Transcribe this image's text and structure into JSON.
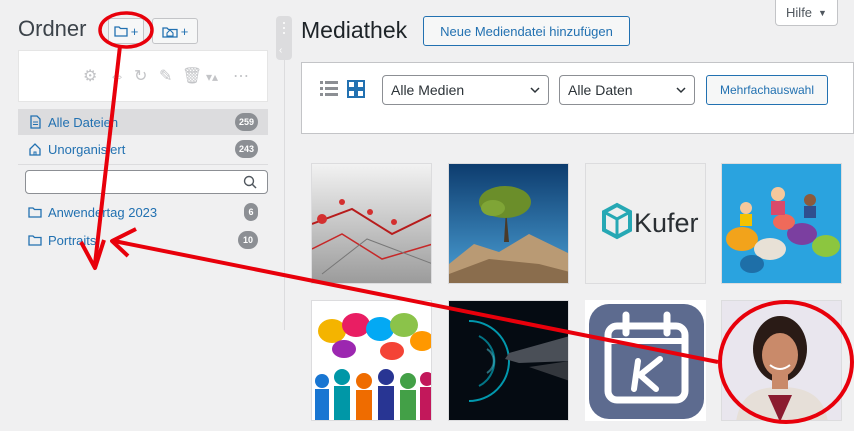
{
  "left": {
    "title": "Ordner",
    "new_folder_label": "+",
    "new_category_label": "+",
    "toolbar_icons": [
      "gear-icon",
      "move-icon",
      "refresh-icon",
      "pencil-icon",
      "trash-icon",
      "sort-icon",
      "more-icon"
    ],
    "items": [
      {
        "label": "Alle Dateien",
        "count": "259",
        "icon": "file-icon"
      },
      {
        "label": "Unorganisiert",
        "count": "243",
        "icon": "home-icon"
      }
    ],
    "search": {
      "placeholder": "",
      "value": ""
    },
    "folders": [
      {
        "label": "Anwendertag 2023",
        "count": "6",
        "icon": "folder-icon"
      },
      {
        "label": "Portraits",
        "count": "10",
        "icon": "folder-icon"
      }
    ]
  },
  "main": {
    "title": "Mediathek",
    "add_button": "Neue Mediendatei hinzufügen",
    "help": "Hilfe",
    "help_caret": "▼",
    "filter_type": "Alle Medien",
    "filter_date": "Alle Daten",
    "multi_select": "Mehrfachauswahl",
    "kufer_text": "Kufer"
  },
  "colors": {
    "accent": "#2271b1",
    "annotation": "#e8000b",
    "badge": "#8c8f94"
  }
}
